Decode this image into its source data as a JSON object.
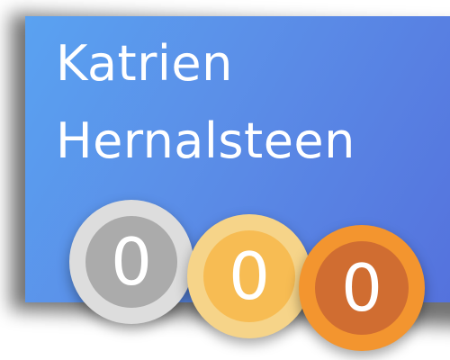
{
  "profile": {
    "first_name": "Katrien",
    "last_name": "Hernalsteen"
  },
  "medals": {
    "silver": {
      "count": "0",
      "color": "#ababab"
    },
    "gold": {
      "count": "0",
      "color": "#f7bc53"
    },
    "bronze": {
      "count": "0",
      "color": "#d06d31"
    }
  },
  "colors": {
    "card_gradient_start": "#5aa2f1",
    "card_gradient_end": "#5470dc"
  }
}
